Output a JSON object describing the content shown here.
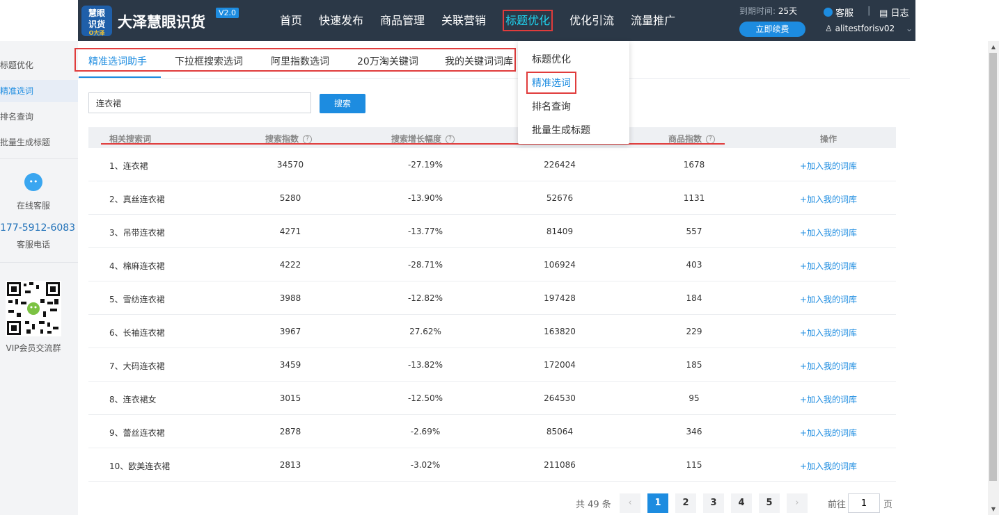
{
  "header": {
    "logo_line1": "慧眼",
    "logo_line2": "识货",
    "logo_sub": "O大泽",
    "app_name": "大泽慧眼识货",
    "version": "V2.0",
    "nav": [
      "首页",
      "快速发布",
      "商品管理",
      "关联营销",
      "标题优化",
      "优化引流",
      "流量推广"
    ],
    "active_nav_index": 4,
    "expire_label": "到期时间:",
    "expire_days": "25天",
    "renew_button": "立即续费",
    "service_label": "客服",
    "separator": "|",
    "log_label": "日志",
    "username": "alitestforisv02",
    "caret": "⌄"
  },
  "sidebar": {
    "items": [
      "标题优化",
      "精准选词",
      "排名查询",
      "批量生成标题"
    ],
    "active_index": 1,
    "online_service": "在线客服",
    "phone": "177-5912-6083",
    "phone_label": "客服电话",
    "vip_group": "VIP会员交流群"
  },
  "subtabs": [
    "精准选词助手",
    "下拉框搜索选词",
    "阿里指数选词",
    "20万淘关键词",
    "我的关键词词库"
  ],
  "active_subtab_index": 0,
  "search": {
    "value": "连衣裙",
    "button": "搜索"
  },
  "dropdown": {
    "items": [
      "标题优化",
      "精准选词",
      "排名查询",
      "批量生成标题"
    ],
    "active_index": 1
  },
  "table": {
    "headers": [
      "相关搜索词",
      "搜索指数",
      "搜索增长幅度",
      "商品指数",
      "操作"
    ],
    "rows": [
      {
        "keyword": "1、连衣裙",
        "search_index": "34570",
        "growth": "-27.19%",
        "value": "226424",
        "goods_index": "1678",
        "action": "+加入我的词库"
      },
      {
        "keyword": "2、真丝连衣裙",
        "search_index": "5280",
        "growth": "-13.90%",
        "value": "52676",
        "goods_index": "1131",
        "action": "+加入我的词库"
      },
      {
        "keyword": "3、吊带连衣裙",
        "search_index": "4271",
        "growth": "-13.77%",
        "value": "81409",
        "goods_index": "557",
        "action": "+加入我的词库"
      },
      {
        "keyword": "4、棉麻连衣裙",
        "search_index": "4222",
        "growth": "-28.71%",
        "value": "106924",
        "goods_index": "403",
        "action": "+加入我的词库"
      },
      {
        "keyword": "5、雪纺连衣裙",
        "search_index": "3988",
        "growth": "-12.82%",
        "value": "197428",
        "goods_index": "184",
        "action": "+加入我的词库"
      },
      {
        "keyword": "6、长袖连衣裙",
        "search_index": "3967",
        "growth": "27.62%",
        "value": "163820",
        "goods_index": "229",
        "action": "+加入我的词库"
      },
      {
        "keyword": "7、大码连衣裙",
        "search_index": "3459",
        "growth": "-13.82%",
        "value": "172004",
        "goods_index": "185",
        "action": "+加入我的词库"
      },
      {
        "keyword": "8、连衣裙女",
        "search_index": "3015",
        "growth": "-12.50%",
        "value": "264530",
        "goods_index": "95",
        "action": "+加入我的词库"
      },
      {
        "keyword": "9、蕾丝连衣裙",
        "search_index": "2878",
        "growth": "-2.69%",
        "value": "85064",
        "goods_index": "346",
        "action": "+加入我的词库"
      },
      {
        "keyword": "10、欧美连衣裙",
        "search_index": "2813",
        "growth": "-3.02%",
        "value": "211086",
        "goods_index": "115",
        "action": "+加入我的词库"
      }
    ]
  },
  "pagination": {
    "total": "共 49 条",
    "prev": "‹",
    "next": "›",
    "pages": [
      "1",
      "2",
      "3",
      "4",
      "5"
    ],
    "active_page": "1",
    "goto_label": "前往",
    "goto_value": "1",
    "goto_suffix": "页"
  },
  "colors": {
    "header_bg": "#2b3847",
    "accent": "#1d8ce0",
    "highlight": "#e03c3c",
    "active_nav": "#1fd3ee"
  }
}
